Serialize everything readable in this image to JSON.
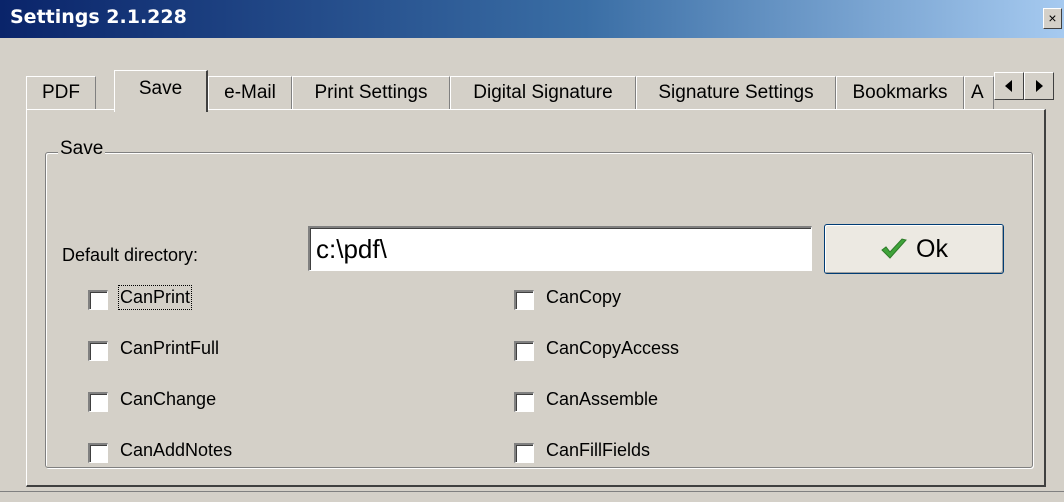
{
  "window": {
    "title": "Settings 2.1.228",
    "close_glyph": "×"
  },
  "tabs": [
    {
      "label": "PDF",
      "active": false
    },
    {
      "label": "Save",
      "active": true
    },
    {
      "label": "e-Mail",
      "active": false
    },
    {
      "label": "Print Settings",
      "active": false
    },
    {
      "label": "Digital Signature",
      "active": false
    },
    {
      "label": "Signature Settings",
      "active": false
    },
    {
      "label": "Bookmarks",
      "active": false
    },
    {
      "label": "A",
      "active": false
    }
  ],
  "tab_scroll": {
    "left_icon": "arrow-left-icon",
    "right_icon": "arrow-right-icon"
  },
  "save_group": {
    "label": "Save",
    "default_directory_label": "Default directory:",
    "default_directory_value": "c:\\pdf\\",
    "ok_label": "Ok",
    "ok_icon": "checkmark-icon",
    "ok_icon_color": "#3fa33a"
  },
  "permissions": {
    "left": [
      {
        "label": "CanPrint",
        "checked": false,
        "focused": true
      },
      {
        "label": "CanPrintFull",
        "checked": false
      },
      {
        "label": "CanChange",
        "checked": false
      },
      {
        "label": "CanAddNotes",
        "checked": false
      }
    ],
    "right": [
      {
        "label": "CanCopy",
        "checked": false
      },
      {
        "label": "CanCopyAccess",
        "checked": false
      },
      {
        "label": "CanAssemble",
        "checked": false
      },
      {
        "label": "CanFillFields",
        "checked": false
      }
    ]
  },
  "colors": {
    "titlebar_start": "#0a246a",
    "titlebar_end": "#a6caf0",
    "face": "#d4d0c8"
  }
}
